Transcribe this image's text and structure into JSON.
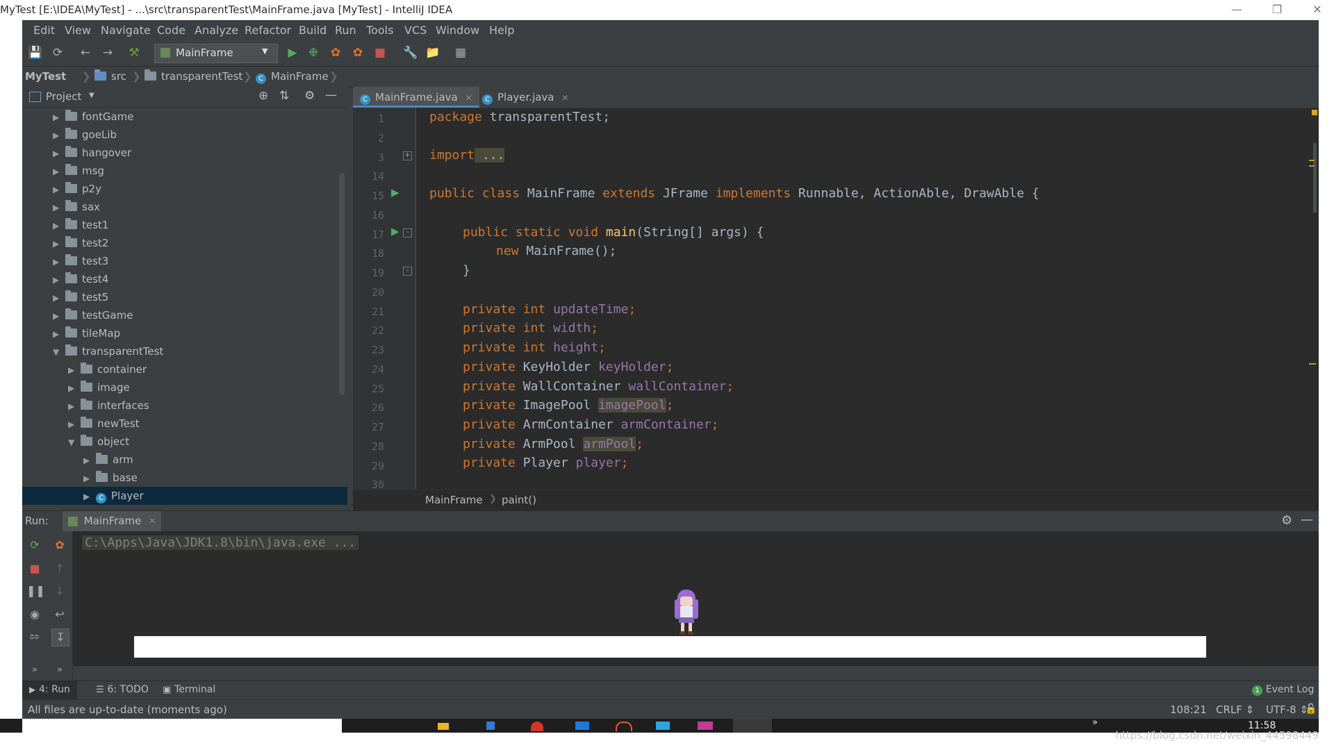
{
  "window": {
    "title": "MyTest [E:\\IDEA\\MyTest] - ...\\src\\transparentTest\\MainFrame.java [MyTest] - IntelliJ IDEA"
  },
  "menu": [
    "Edit",
    "View",
    "Navigate",
    "Code",
    "Analyze",
    "Refactor",
    "Build",
    "Run",
    "Tools",
    "VCS",
    "Window",
    "Help"
  ],
  "toolbar": {
    "run_config": "MainFrame"
  },
  "navbar": {
    "project": "MyTest",
    "src": "src",
    "package": "transparentTest",
    "class": "MainFrame"
  },
  "project_panel": {
    "title": "Project",
    "tree": [
      {
        "label": "fontGame"
      },
      {
        "label": "goeLib"
      },
      {
        "label": "hangover"
      },
      {
        "label": "msg"
      },
      {
        "label": "p2y"
      },
      {
        "label": "sax"
      },
      {
        "label": "test1"
      },
      {
        "label": "test2"
      },
      {
        "label": "test3"
      },
      {
        "label": "test4"
      },
      {
        "label": "test5"
      },
      {
        "label": "testGame"
      },
      {
        "label": "tileMap"
      },
      {
        "label": "transparentTest"
      },
      {
        "label": "container"
      },
      {
        "label": "image"
      },
      {
        "label": "interfaces"
      },
      {
        "label": "newTest"
      },
      {
        "label": "object"
      },
      {
        "label": "arm"
      },
      {
        "label": "base"
      },
      {
        "label": "Player"
      }
    ]
  },
  "tabs": [
    {
      "label": "MainFrame.java"
    },
    {
      "label": "Player.java"
    }
  ],
  "editor": {
    "line_numbers": [
      "1",
      "2",
      "3",
      "14",
      "15",
      "16",
      "17",
      "18",
      "19",
      "20",
      "21",
      "22",
      "23",
      "24",
      "25",
      "26",
      "27",
      "28",
      "29",
      "30"
    ],
    "code": {
      "l1_kw": "package",
      "l1_rest": " transparentTest;",
      "l3_kw": "import",
      "l3_rest": " ...",
      "l15_a": "public class",
      "l15_b": " MainFrame ",
      "l15_c": "extends",
      "l15_d": " JFrame ",
      "l15_e": "implements",
      "l15_f": " Runnable, ActionAble, DrawAble {",
      "l17_a": "public static void",
      "l17_fn": "main",
      "l17_rest": "(String[] args) {",
      "l18_kw": "new",
      "l18_rest": " MainFrame();",
      "l19": "}",
      "l21_kw": "private int",
      "l21_f": "updateTime",
      "l22_kw": "private int",
      "l22_f": "width",
      "l23_kw": "private int",
      "l23_f": "height",
      "l24_kw": "private",
      "l24_t": " KeyHolder ",
      "l24_f": "keyHolder",
      "l25_kw": "private",
      "l25_t": " WallContainer ",
      "l25_f": "wallContainer",
      "l26_kw": "private",
      "l26_t": " ImagePool ",
      "l26_f": "imagePool",
      "l27_kw": "private",
      "l27_t": " ArmContainer ",
      "l27_f": "armContainer",
      "l28_kw": "private",
      "l28_t": " ArmPool ",
      "l28_f": "armPool",
      "l29_kw": "private",
      "l29_t": " Player ",
      "l29_f": "player",
      "semi": ";"
    },
    "breadcrumb": {
      "class": "MainFrame",
      "method": "paint()"
    }
  },
  "run_panel": {
    "label": "Run:",
    "tab": "MainFrame",
    "console_line": "C:\\Apps\\Java\\JDK1.8\\bin\\java.exe ..."
  },
  "tool_windows": [
    {
      "label": "4: Run"
    },
    {
      "label": "6: TODO"
    },
    {
      "label": "Terminal"
    }
  ],
  "event_log": "Event Log",
  "event_count": "1",
  "status": {
    "message": "All files are up-to-date (moments ago)",
    "position": "108:21",
    "line_sep": "CRLF",
    "encoding": "UTF-8"
  },
  "taskbar": {
    "time": "11:58"
  },
  "watermark": "https://blog.csdn.net/weixin_44598449"
}
